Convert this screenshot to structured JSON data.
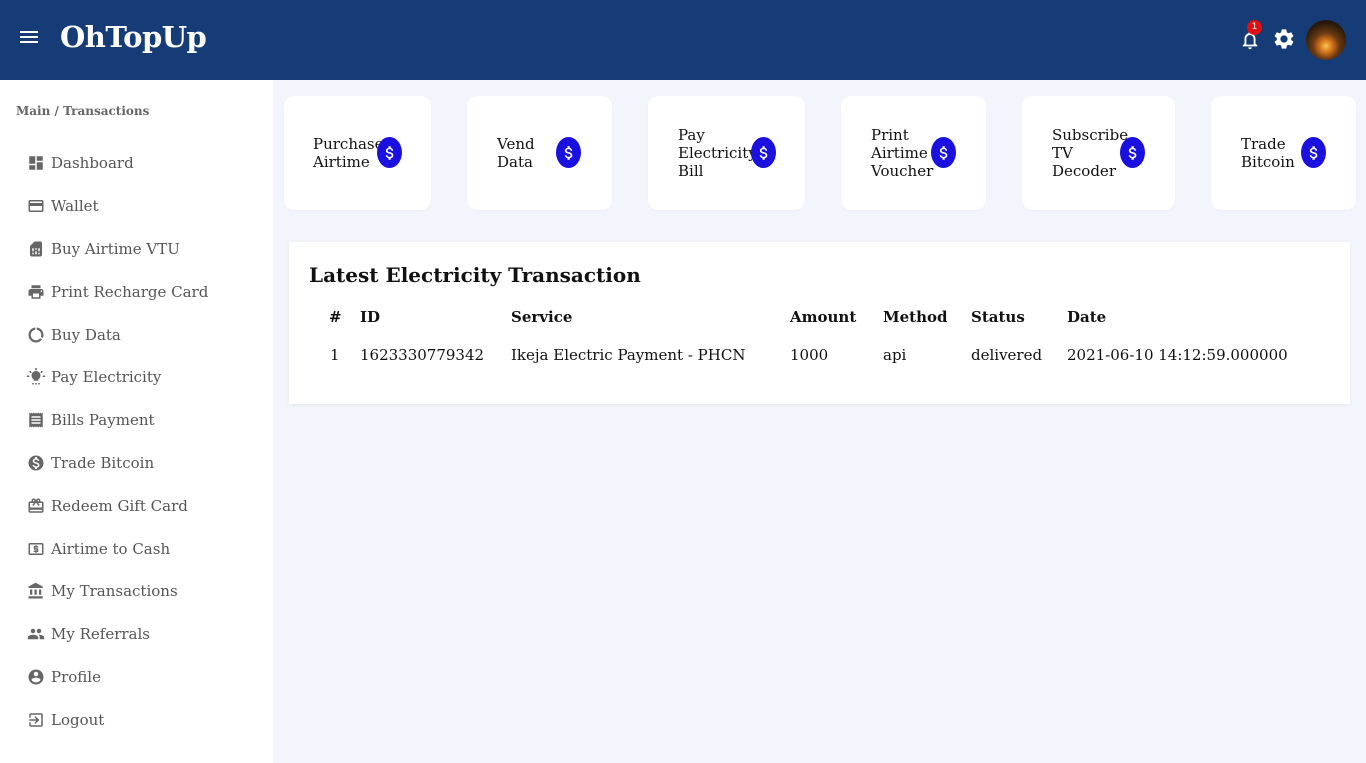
{
  "header": {
    "brand": "OhTopUp",
    "notification_count": "1"
  },
  "sidebar": {
    "breadcrumb": "Main / Transactions",
    "items": [
      {
        "label": "Dashboard",
        "icon": "dashboard-icon"
      },
      {
        "label": "Wallet",
        "icon": "wallet-icon"
      },
      {
        "label": "Buy Airtime VTU",
        "icon": "sim-card-icon"
      },
      {
        "label": "Print Recharge Card",
        "icon": "printer-icon"
      },
      {
        "label": "Buy Data",
        "icon": "data-usage-icon"
      },
      {
        "label": "Pay Electricity",
        "icon": "lightbulb-icon"
      },
      {
        "label": "Bills Payment",
        "icon": "receipt-icon"
      },
      {
        "label": "Trade Bitcoin",
        "icon": "dollar-circle-icon"
      },
      {
        "label": "Redeem Gift Card",
        "icon": "gift-card-icon"
      },
      {
        "label": "Airtime to Cash",
        "icon": "cash-icon"
      },
      {
        "label": "My Transactions",
        "icon": "bank-icon"
      },
      {
        "label": "My Referrals",
        "icon": "people-icon"
      },
      {
        "label": "Profile",
        "icon": "account-circle-icon"
      },
      {
        "label": "Logout",
        "icon": "logout-icon"
      }
    ]
  },
  "quick_actions": [
    {
      "label": "Purchase\nAirtime",
      "icon": "dollar-coin-icon"
    },
    {
      "label": "Vend\nData",
      "icon": "dollar-coin-icon"
    },
    {
      "label": "Pay\nElectricity\nBill",
      "icon": "dollar-coin-icon"
    },
    {
      "label": "Print\nAirtime\nVoucher",
      "icon": "dollar-coin-icon"
    },
    {
      "label": "Subscribe\nTV\nDecoder",
      "icon": "dollar-coin-icon"
    },
    {
      "label": "Trade\nBitcoin",
      "icon": "dollar-coin-icon"
    }
  ],
  "transactions": {
    "title": "Latest Electricity Transaction",
    "columns": [
      "#",
      "ID",
      "Service",
      "Amount",
      "Method",
      "Status",
      "Date"
    ],
    "rows": [
      [
        "1",
        "1623330779342",
        "Ikeja Electric Payment - PHCN",
        "1000",
        "api",
        "delivered",
        "2021-06-10 14:12:59.000000"
      ]
    ]
  },
  "colors": {
    "header_bg": "#153c77",
    "page_bg": "#f3f5fc",
    "coin_blue": "#1a10e0",
    "badge_red": "#e01010"
  }
}
